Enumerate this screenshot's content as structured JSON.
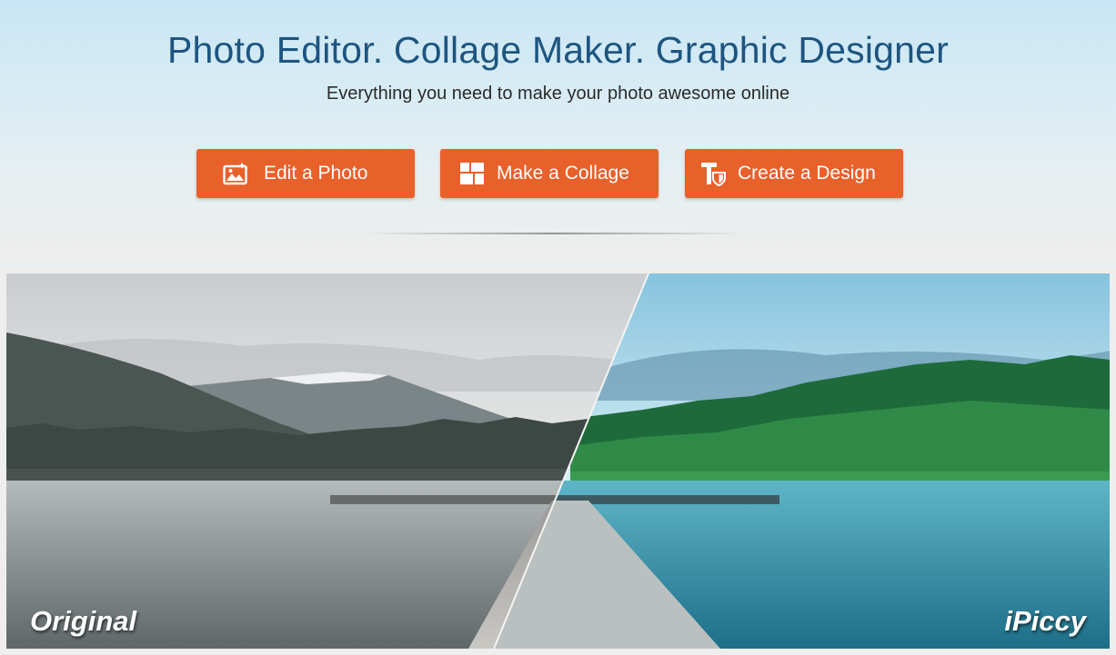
{
  "header": {
    "title": "Photo Editor. Collage Maker. Graphic Designer",
    "subtitle": "Everything you need to make your photo awesome online"
  },
  "buttons": [
    {
      "label": "Edit a Photo",
      "icon": "photo-edit-icon"
    },
    {
      "label": "Make a Collage",
      "icon": "collage-grid-icon"
    },
    {
      "label": "Create a Design",
      "icon": "design-text-icon"
    }
  ],
  "showcase": {
    "left_label": "Original",
    "right_label": "iPiccy"
  },
  "colors": {
    "accent": "#e8602a",
    "title": "#1d5580"
  }
}
